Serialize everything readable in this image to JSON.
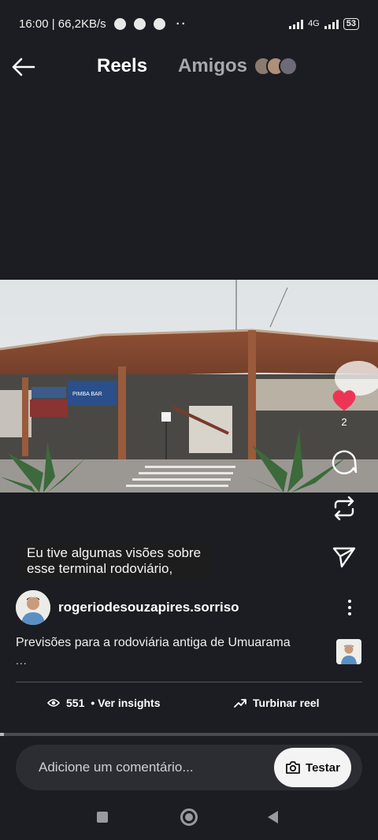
{
  "status_bar": {
    "time_speed": "16:00 | 66,2KB/s",
    "network": "4G",
    "battery": "53",
    "notification_icons": [
      "messenger-icon",
      "chat-icon",
      "facebook-icon"
    ]
  },
  "nav": {
    "tab_reels": "Reels",
    "tab_friends": "Amigos"
  },
  "actions": {
    "like_count": "2",
    "like_color": "#ee3454"
  },
  "subtitle": {
    "line1": "Eu tive algumas visões sobre",
    "line2": "esse terminal rodoviário,"
  },
  "video_signs": {
    "bar_sign": "PIMBA BAR"
  },
  "post": {
    "username": "rogeriodesouzapires.sorriso",
    "caption": "Previsões para a rodoviária antiga de Umuarama",
    "caption_more": "..."
  },
  "stats": {
    "views": "551",
    "insights_label": "• Ver insights",
    "boost_label": "Turbinar reel"
  },
  "playback": {
    "progress": 0.01
  },
  "comment": {
    "placeholder": "Adicione um comentário...",
    "try_label": "Testar"
  }
}
